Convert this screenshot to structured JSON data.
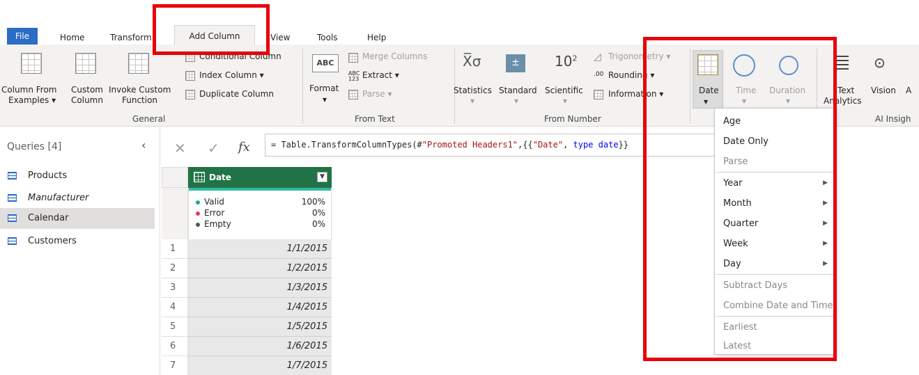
{
  "tabs": [
    "File",
    "Home",
    "Transform",
    "Add Column",
    "View",
    "Tools",
    "Help"
  ],
  "ribbon": {
    "general": {
      "label": "General",
      "col_from_examples": [
        "Column From",
        "Examples"
      ],
      "custom_column": [
        "Custom",
        "Column"
      ],
      "invoke_custom_function": [
        "Invoke Custom",
        "Function"
      ],
      "conditional_column": "Conditional Column",
      "index_column": "Index Column",
      "duplicate_column": "Duplicate Column"
    },
    "from_text": {
      "label": "From Text",
      "format": "Format",
      "merge_columns": "Merge Columns",
      "extract": "Extract",
      "parse": "Parse"
    },
    "from_number": {
      "label": "From Number",
      "statistics": "Statistics",
      "standard": "Standard",
      "scientific": "Scientific",
      "trigonometry": "Trigonometry",
      "rounding": "Rounding",
      "information": "Information"
    },
    "from_date": {
      "date": "Date",
      "time": "Time",
      "duration": "Duration"
    },
    "ai": {
      "label": "AI Insigh",
      "text_analytics": [
        "Text",
        "Analytics"
      ],
      "vision": "Vision",
      "extra": "A"
    }
  },
  "queries": {
    "title": "Queries [4]",
    "items": [
      "Products",
      "Manufacturer",
      "Calendar",
      "Customers"
    ],
    "selected": "Calendar"
  },
  "formula": {
    "prefix": "= Table.TransformColumnTypes(#",
    "s1": "\"Promoted Headers1\"",
    "mid": ",{{",
    "s2": "\"Date\"",
    "comma": ", ",
    "kw": "type date",
    "tail": "}}"
  },
  "grid": {
    "column": "Date",
    "quality": [
      {
        "label": "Valid",
        "value": "100%",
        "color": "#1aa99a"
      },
      {
        "label": "Error",
        "value": "0%",
        "color": "#e5404d"
      },
      {
        "label": "Empty",
        "value": "0%",
        "color": "#555555"
      }
    ],
    "rows": [
      "1/1/2015",
      "1/2/2015",
      "1/3/2015",
      "1/4/2015",
      "1/5/2015",
      "1/6/2015",
      "1/7/2015"
    ],
    "row_numbers": [
      "1",
      "2",
      "3",
      "4",
      "5",
      "6",
      "7"
    ]
  },
  "date_menu": {
    "items": [
      "Age",
      "Date Only",
      "Parse",
      "Year",
      "Month",
      "Quarter",
      "Week",
      "Day",
      "Subtract Days",
      "Combine Date and Time",
      "Earliest",
      "Latest"
    ]
  },
  "colors": {
    "accent_blue": "#2b6cc4",
    "header_green": "#217346",
    "highlight_red": "#e8000b"
  }
}
